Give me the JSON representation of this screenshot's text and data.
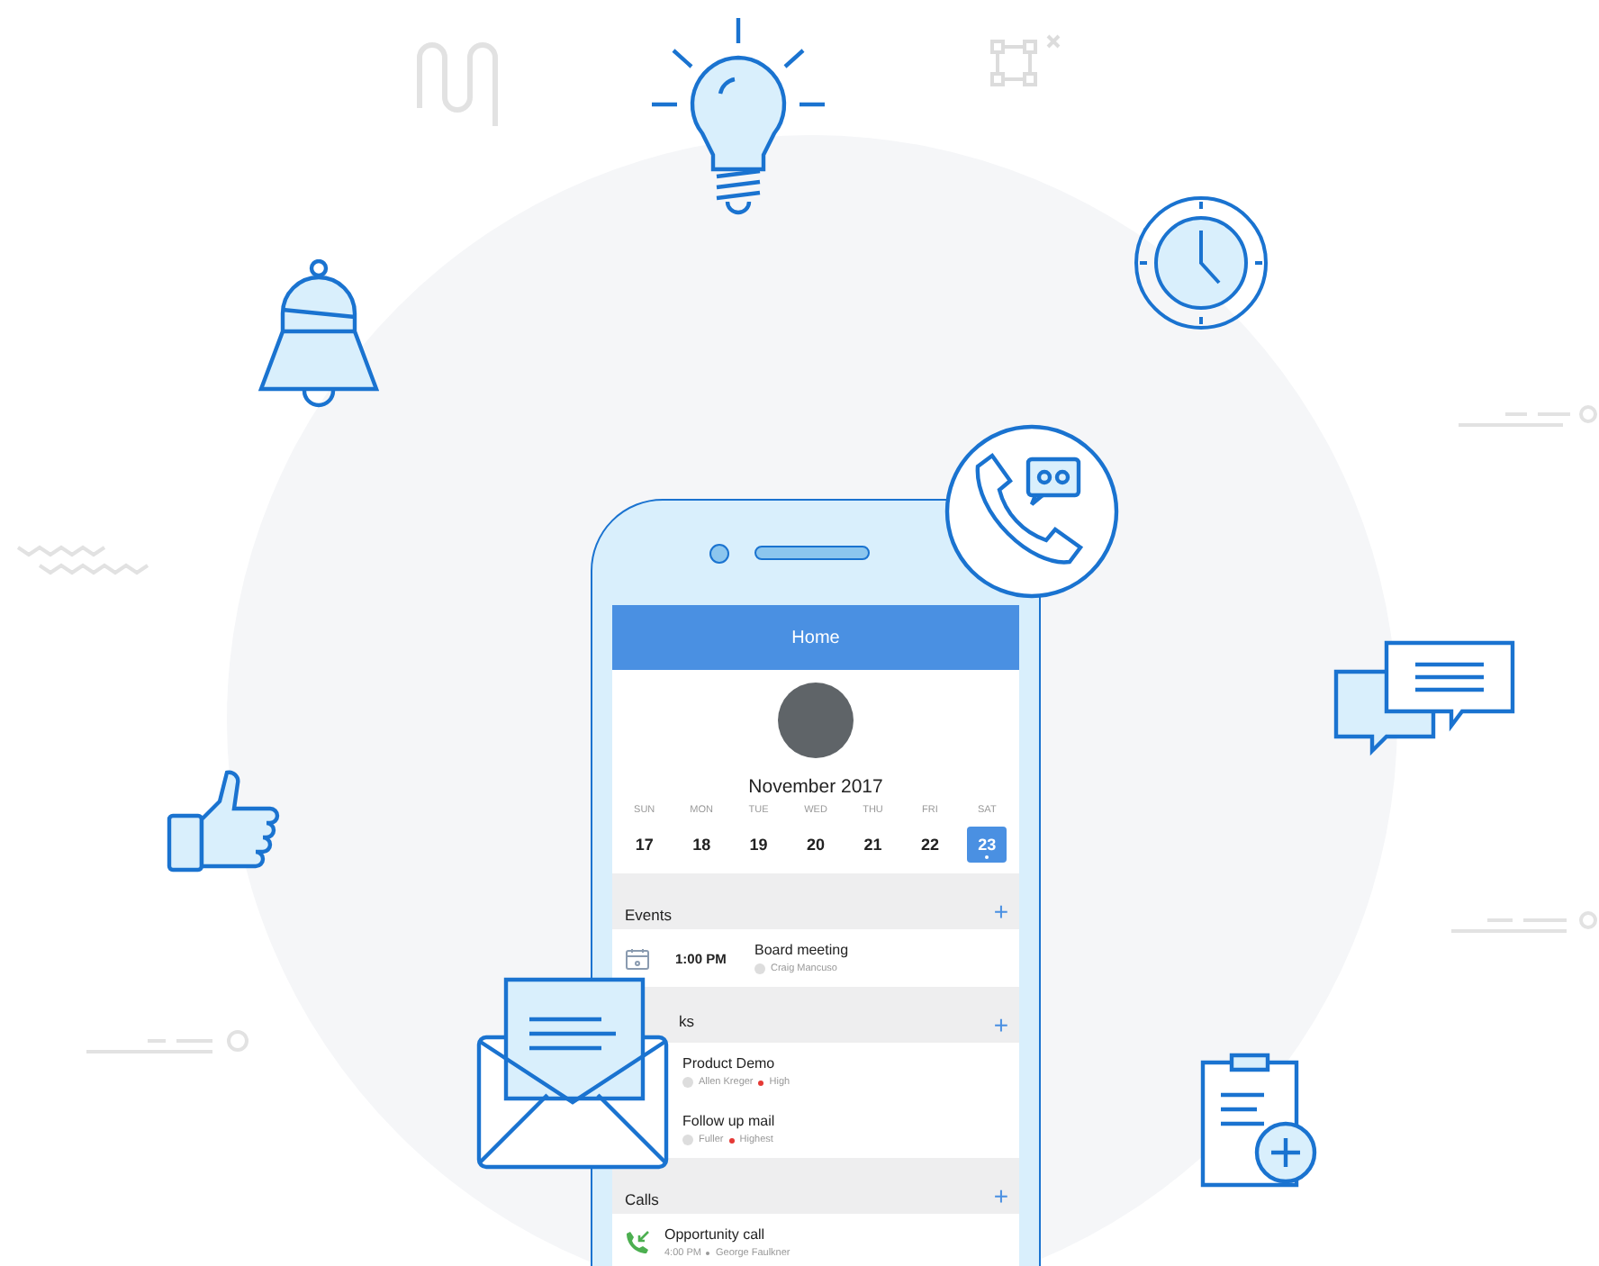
{
  "header": {
    "title": "Home"
  },
  "calendar": {
    "month": "November 2017",
    "days": [
      {
        "weekday": "SUN",
        "date": "17",
        "selected": false
      },
      {
        "weekday": "MON",
        "date": "18",
        "selected": false
      },
      {
        "weekday": "TUE",
        "date": "19",
        "selected": false
      },
      {
        "weekday": "WED",
        "date": "20",
        "selected": false
      },
      {
        "weekday": "THU",
        "date": "21",
        "selected": false
      },
      {
        "weekday": "FRI",
        "date": "22",
        "selected": false
      },
      {
        "weekday": "SAT",
        "date": "23",
        "selected": true
      }
    ]
  },
  "sections": [
    {
      "kind": "events",
      "title": "Events",
      "add": "+",
      "items": [
        {
          "time": "1:00 PM",
          "title": "Board meeting",
          "person": "Craig Mancuso"
        }
      ]
    },
    {
      "kind": "tasks",
      "title": "ks",
      "add": "+",
      "items": [
        {
          "title": "Product Demo",
          "person": "Allen Kreger",
          "priority": "High",
          "color": "#e53935"
        },
        {
          "title": "Follow up mail",
          "person": "Fuller",
          "priority": "Highest",
          "color": "#e53935"
        }
      ]
    },
    {
      "kind": "calls",
      "title": "Calls",
      "add": "+",
      "items": [
        {
          "title": "Opportunity call",
          "time": "4:00 PM",
          "person": "George Faulkner"
        }
      ]
    }
  ]
}
